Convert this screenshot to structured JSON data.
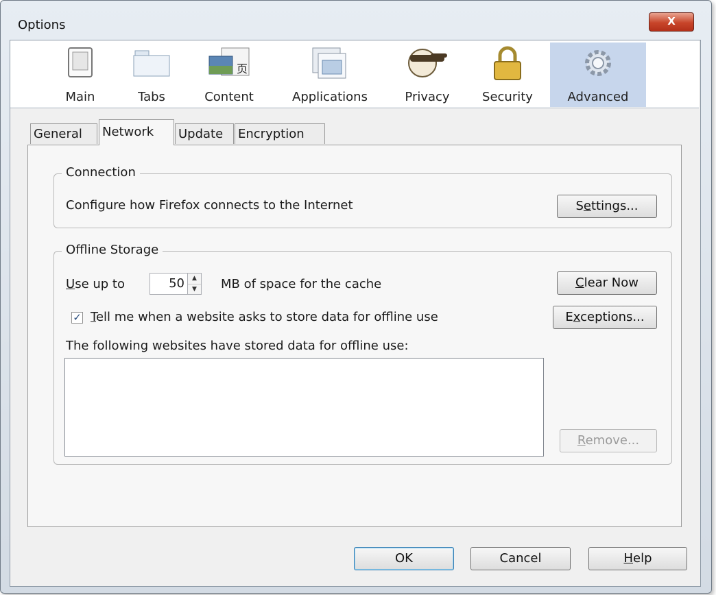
{
  "window": {
    "title": "Options",
    "close_glyph": "X"
  },
  "panes": [
    {
      "label": "Main",
      "icon": "main-pane-icon"
    },
    {
      "label": "Tabs",
      "icon": "tabs-pane-icon"
    },
    {
      "label": "Content",
      "icon": "content-pane-icon"
    },
    {
      "label": "Applications",
      "icon": "applications-pane-icon"
    },
    {
      "label": "Privacy",
      "icon": "privacy-mask-icon"
    },
    {
      "label": "Security",
      "icon": "padlock-icon"
    },
    {
      "label": "Advanced",
      "icon": "gear-icon",
      "selected": true
    }
  ],
  "tabs": [
    {
      "label": "General"
    },
    {
      "label": "Network",
      "active": true
    },
    {
      "label": "Update"
    },
    {
      "label": "Encryption"
    }
  ],
  "connection": {
    "caption": "Connection",
    "description": "Configure how Firefox connects to the Internet",
    "settings_button": {
      "prefix": "S",
      "accel": "e",
      "rest": "ttings..."
    }
  },
  "offline": {
    "caption": "Offline Storage",
    "use_up_to": {
      "accel": "U",
      "rest": "se up to"
    },
    "cache_size": "50",
    "cache_suffix": "MB of space for the cache",
    "clear_now": {
      "accel": "C",
      "rest": "lear Now"
    },
    "notify_checked": true,
    "checkbox_glyph": "✓",
    "notify_label": {
      "accel": "T",
      "rest": "ell me when a website asks to store data for offline use"
    },
    "exceptions": {
      "prefix": "E",
      "accel": "x",
      "rest": "ceptions..."
    },
    "list_label": "The following websites have stored data for offline use:",
    "remove": {
      "accel": "R",
      "rest": "emove..."
    }
  },
  "footer": {
    "ok": "OK",
    "cancel": "Cancel",
    "help": {
      "accel": "H",
      "rest": "elp"
    }
  }
}
